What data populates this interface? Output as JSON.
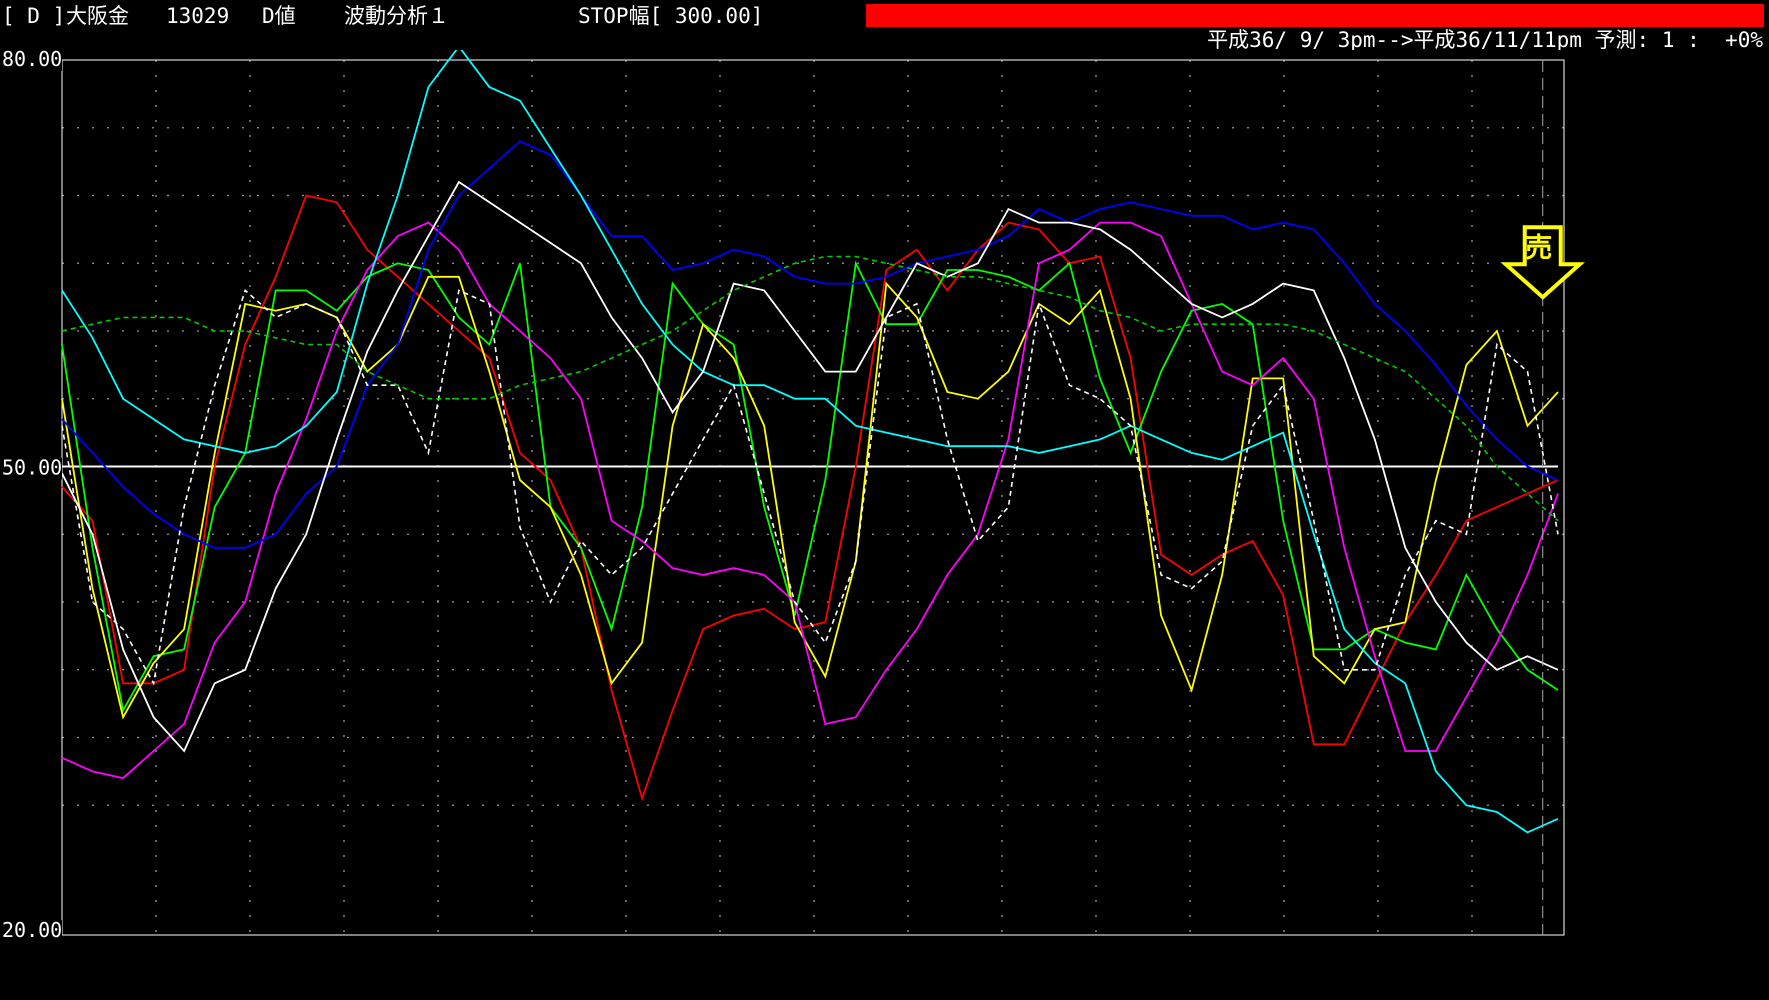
{
  "header": {
    "tag": "[ D ]",
    "instrument": "大阪金",
    "code": "13029",
    "value_type": "D値",
    "analysis": "波動分析１",
    "stop_width": "STOP幅[ 300.00]",
    "period": "平成36/ 9/ 3pm-->平成36/11/11pm 予測: 1 :  +0%"
  },
  "colors": {
    "background": "#000000",
    "stop_bar": "#ff0000",
    "grid": "#9a9a9a",
    "frame": "#ffffff",
    "signal_arrow": "#ffff00"
  },
  "chart_data": {
    "type": "line",
    "ylim": [
      20,
      80
    ],
    "xlim": [
      0,
      49
    ],
    "y_ticks": [
      "80.00",
      "50.00",
      "20.00"
    ],
    "reference_line": 50,
    "grid": true,
    "signal": {
      "label": "売",
      "x": 48.5,
      "y": 62.2
    },
    "x": [
      0,
      1,
      2,
      3,
      4,
      5,
      6,
      7,
      8,
      9,
      10,
      11,
      12,
      13,
      14,
      15,
      16,
      17,
      18,
      19,
      20,
      21,
      22,
      23,
      24,
      25,
      26,
      27,
      28,
      29,
      30,
      31,
      32,
      33,
      34,
      35,
      36,
      37,
      38,
      39,
      40,
      41,
      42,
      43,
      44,
      45,
      46,
      47,
      48,
      49
    ],
    "series": [
      {
        "color": "#ff0000",
        "dash": false,
        "values": [
          48.5,
          46,
          34,
          34,
          35,
          50,
          59,
          64,
          70,
          69.5,
          66,
          64,
          62,
          60,
          58,
          51,
          49,
          44,
          33.5,
          25.5,
          32,
          38,
          39,
          39.5,
          38,
          38.5,
          50,
          64.5,
          66,
          63,
          66,
          68,
          67.5,
          65,
          65.5,
          58,
          43.5,
          42,
          43.5,
          44.5,
          40.5,
          29.5,
          29.5,
          34,
          38.5,
          42,
          46,
          47,
          48,
          49
        ]
      },
      {
        "color": "#00ff00",
        "dash": false,
        "values": [
          59,
          44,
          32,
          36,
          36.5,
          47,
          51,
          63,
          63,
          61.5,
          64,
          65,
          64.5,
          61,
          59,
          65,
          47,
          44,
          38,
          47,
          63.5,
          60.5,
          59,
          47,
          39,
          49,
          65,
          60.5,
          60.5,
          64.5,
          64.5,
          64,
          63,
          65,
          56.5,
          51,
          57,
          61.5,
          62,
          60.5,
          46,
          36.5,
          36.5,
          38,
          37,
          36.5,
          42,
          38,
          35,
          33.5
        ]
      },
      {
        "color": "#ffff00",
        "dash": false,
        "values": [
          55,
          41,
          31.5,
          35.5,
          38,
          51,
          62,
          61.5,
          62,
          61,
          57,
          59,
          64,
          64,
          57,
          49,
          47,
          42,
          34,
          37,
          53,
          60.5,
          58,
          53,
          38.5,
          34.5,
          43,
          63.5,
          61,
          55.5,
          55,
          57,
          62,
          60.5,
          63,
          55,
          39,
          33.5,
          42,
          56.5,
          56.5,
          36,
          34,
          38,
          38.5,
          49,
          57.5,
          60,
          53,
          55.5
        ]
      },
      {
        "color": "#ff00ff",
        "dash": false,
        "values": [
          28.5,
          27.5,
          27,
          29,
          31,
          37,
          40,
          48,
          53.5,
          60,
          64.5,
          67,
          68,
          66,
          62,
          60,
          58,
          55,
          46,
          44.5,
          42.5,
          42,
          42.5,
          42,
          40,
          31,
          31.5,
          35,
          38,
          42,
          45,
          52,
          65,
          66,
          68,
          68,
          67,
          62,
          57,
          56,
          58,
          55,
          44,
          36,
          29,
          29,
          33,
          37,
          42,
          48
        ]
      },
      {
        "color": "#0000ff",
        "dash": false,
        "values": [
          53.5,
          51,
          48.5,
          46.5,
          45,
          44,
          44,
          45,
          48,
          50,
          56,
          59,
          66,
          70,
          72,
          74,
          73,
          70,
          67,
          67,
          64.5,
          65,
          66,
          65.5,
          64,
          63.5,
          63.5,
          64,
          65,
          65.5,
          66,
          67,
          69,
          68,
          69,
          69.5,
          69,
          68.5,
          68.5,
          67.5,
          68,
          67.5,
          65,
          62,
          60,
          57.5,
          54.5,
          52,
          50,
          49
        ]
      },
      {
        "color": "#00ffff",
        "dash": false,
        "values": [
          63,
          59.5,
          55,
          53.5,
          52,
          51.5,
          51,
          51.5,
          53,
          55.5,
          63.5,
          70,
          78,
          81,
          78,
          77,
          73.5,
          70,
          66,
          62,
          59,
          57,
          56,
          56,
          55,
          55,
          53,
          52.5,
          52,
          51.5,
          51.5,
          51.5,
          51,
          51.5,
          52,
          53,
          52,
          51,
          50.5,
          51.5,
          52.5,
          45,
          38,
          35.5,
          34,
          27.5,
          25,
          24.5,
          23,
          24
        ]
      },
      {
        "color": "#ffffff",
        "dash": false,
        "values": [
          49.5,
          45,
          36.5,
          31.5,
          29,
          34,
          35,
          41,
          45,
          52,
          58.5,
          63,
          67,
          71,
          69.5,
          68,
          66.5,
          65,
          61,
          58,
          54,
          57,
          63.5,
          63,
          60,
          57,
          57,
          61,
          65,
          64,
          65,
          69,
          68,
          68,
          67.5,
          66,
          64,
          62,
          61,
          62,
          63.5,
          63,
          58,
          52,
          44,
          40,
          37,
          35,
          36,
          35
        ]
      },
      {
        "color": "#ffffff",
        "dash": true,
        "values": [
          53,
          40,
          38,
          34,
          47,
          56,
          63,
          61,
          62,
          61,
          56,
          56,
          51,
          63,
          62,
          45.5,
          40,
          44.5,
          42,
          44,
          48,
          52,
          56,
          48,
          40,
          37,
          43,
          61,
          62,
          52,
          44.5,
          47,
          62,
          56,
          55,
          53,
          42,
          41,
          43,
          53,
          56,
          46,
          35,
          35,
          42,
          46,
          45,
          59,
          57,
          45
        ]
      },
      {
        "color": "#00cc00",
        "dash": true,
        "values": [
          60,
          60.5,
          61,
          61,
          61,
          60,
          60,
          59.5,
          59,
          59,
          57,
          56,
          55,
          55,
          55,
          56,
          56.5,
          57,
          58,
          59,
          60,
          61.5,
          63,
          64,
          65,
          65.5,
          65.5,
          65,
          64.5,
          64,
          64,
          63.5,
          63,
          62.5,
          61.5,
          61,
          60,
          60.5,
          60.5,
          60.5,
          60.5,
          60,
          59,
          58,
          57,
          55,
          53,
          50,
          48,
          46
        ]
      }
    ]
  }
}
